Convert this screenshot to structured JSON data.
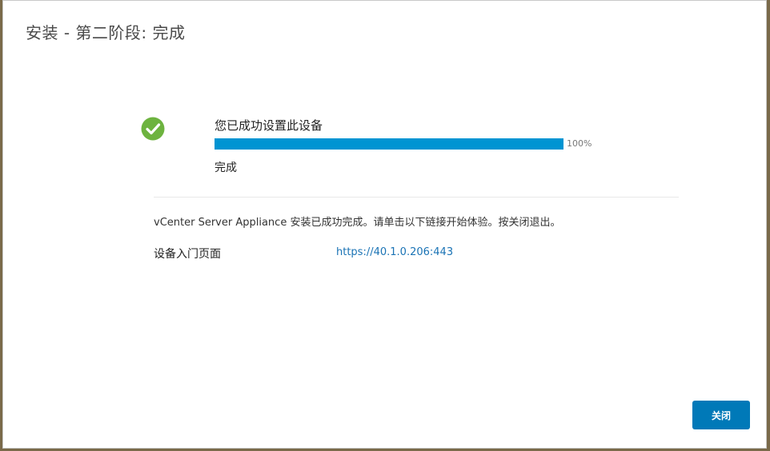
{
  "dialog": {
    "title": "安装 - 第二阶段: 完成"
  },
  "status": {
    "icon": "check-circle-icon",
    "icon_color": "#6db33f",
    "title": "您已成功设置此设备",
    "progress_value": 100,
    "progress_label": "100%",
    "detail": "完成",
    "bar_color": "#0094d2"
  },
  "message": "vCenter Server Appliance 安装已成功完成。请单击以下链接开始体验。按关闭退出。",
  "portal": {
    "label": "设备入门页面",
    "url": "https://40.1.0.206:443"
  },
  "footer": {
    "close_label": "关闭",
    "button_color": "#0079b8"
  }
}
